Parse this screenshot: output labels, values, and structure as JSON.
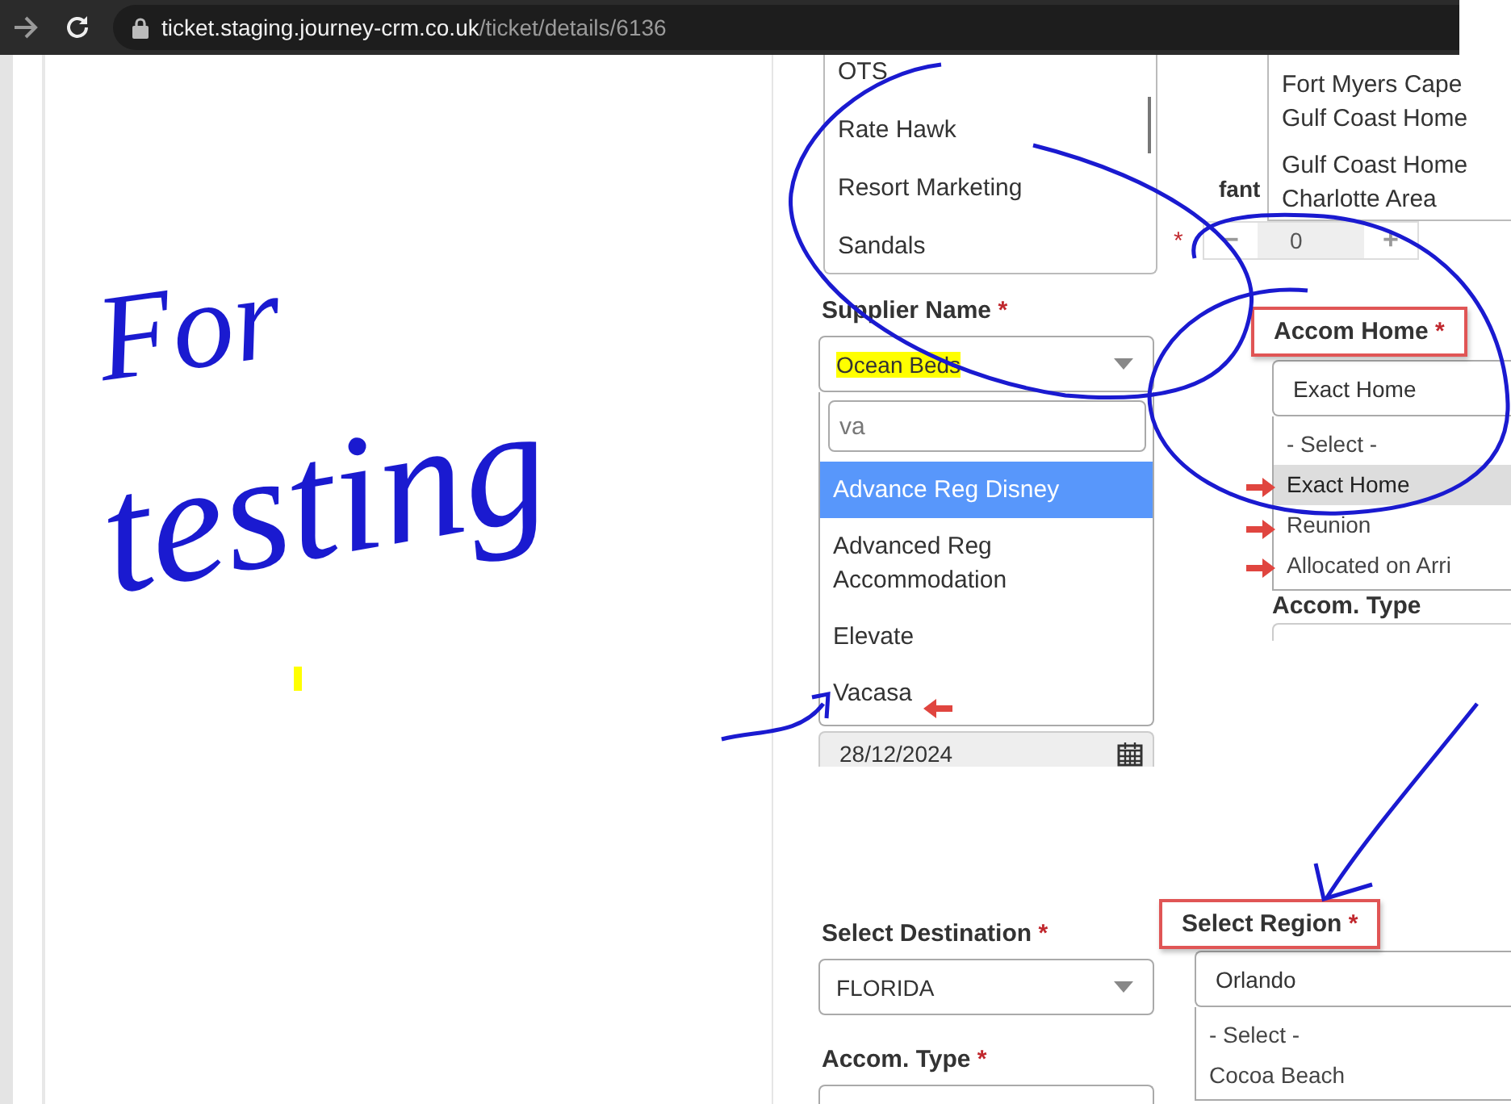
{
  "browser": {
    "host": "ticket.staging.journey-crm.co.uk",
    "path": "/ticket/details/6136"
  },
  "supplier_list": {
    "items": [
      "OTS",
      "Rate Hawk",
      "Resort Marketing",
      "Sandals"
    ]
  },
  "area_list": {
    "items": [
      {
        "lines": [
          "Fort Myers Cape",
          "Gulf Coast Home"
        ]
      },
      {
        "lines": [
          "Gulf Coast Home",
          "Charlotte Area"
        ]
      }
    ]
  },
  "infant": {
    "label": "fant",
    "mark": "*",
    "minus": "−",
    "value": "0",
    "plus": "+"
  },
  "supplier": {
    "label": "Supplier Name",
    "mark": "*",
    "boxed": false,
    "value": "Ocean Beds",
    "search": "va",
    "options": [
      {
        "label": "Advance Reg Disney",
        "selected": true
      },
      {
        "label": "Advanced Reg Accommodation",
        "selected": false
      },
      {
        "label": "Elevate",
        "selected": false
      },
      {
        "label": "Vacasa",
        "selected": false
      }
    ]
  },
  "travel_date": {
    "value": "28/12/2024"
  },
  "accom_home": {
    "label": "Accom Home",
    "mark": "*",
    "boxed": true,
    "value": "Exact Home",
    "options": [
      {
        "label": "- Select -",
        "selected": false
      },
      {
        "label": "Exact Home",
        "selected": true
      },
      {
        "label": "Reunion",
        "selected": false
      },
      {
        "label": "Allocated on Arri",
        "selected": false
      }
    ]
  },
  "accom_type_right": {
    "label": "Accom. Type"
  },
  "destination": {
    "label": "Select Destination",
    "mark": "*",
    "boxed": false,
    "value": "FLORIDA"
  },
  "region": {
    "label": "Select Region",
    "mark": "*",
    "boxed": true,
    "value": "Orlando",
    "options": [
      {
        "label": "- Select -",
        "selected": false
      },
      {
        "label": "Cocoa Beach",
        "selected": false
      }
    ]
  },
  "accom_type": {
    "label": "Accom. Type",
    "mark": "*",
    "boxed": false
  },
  "annotation": {
    "lines": [
      "For",
      "testing"
    ]
  }
}
